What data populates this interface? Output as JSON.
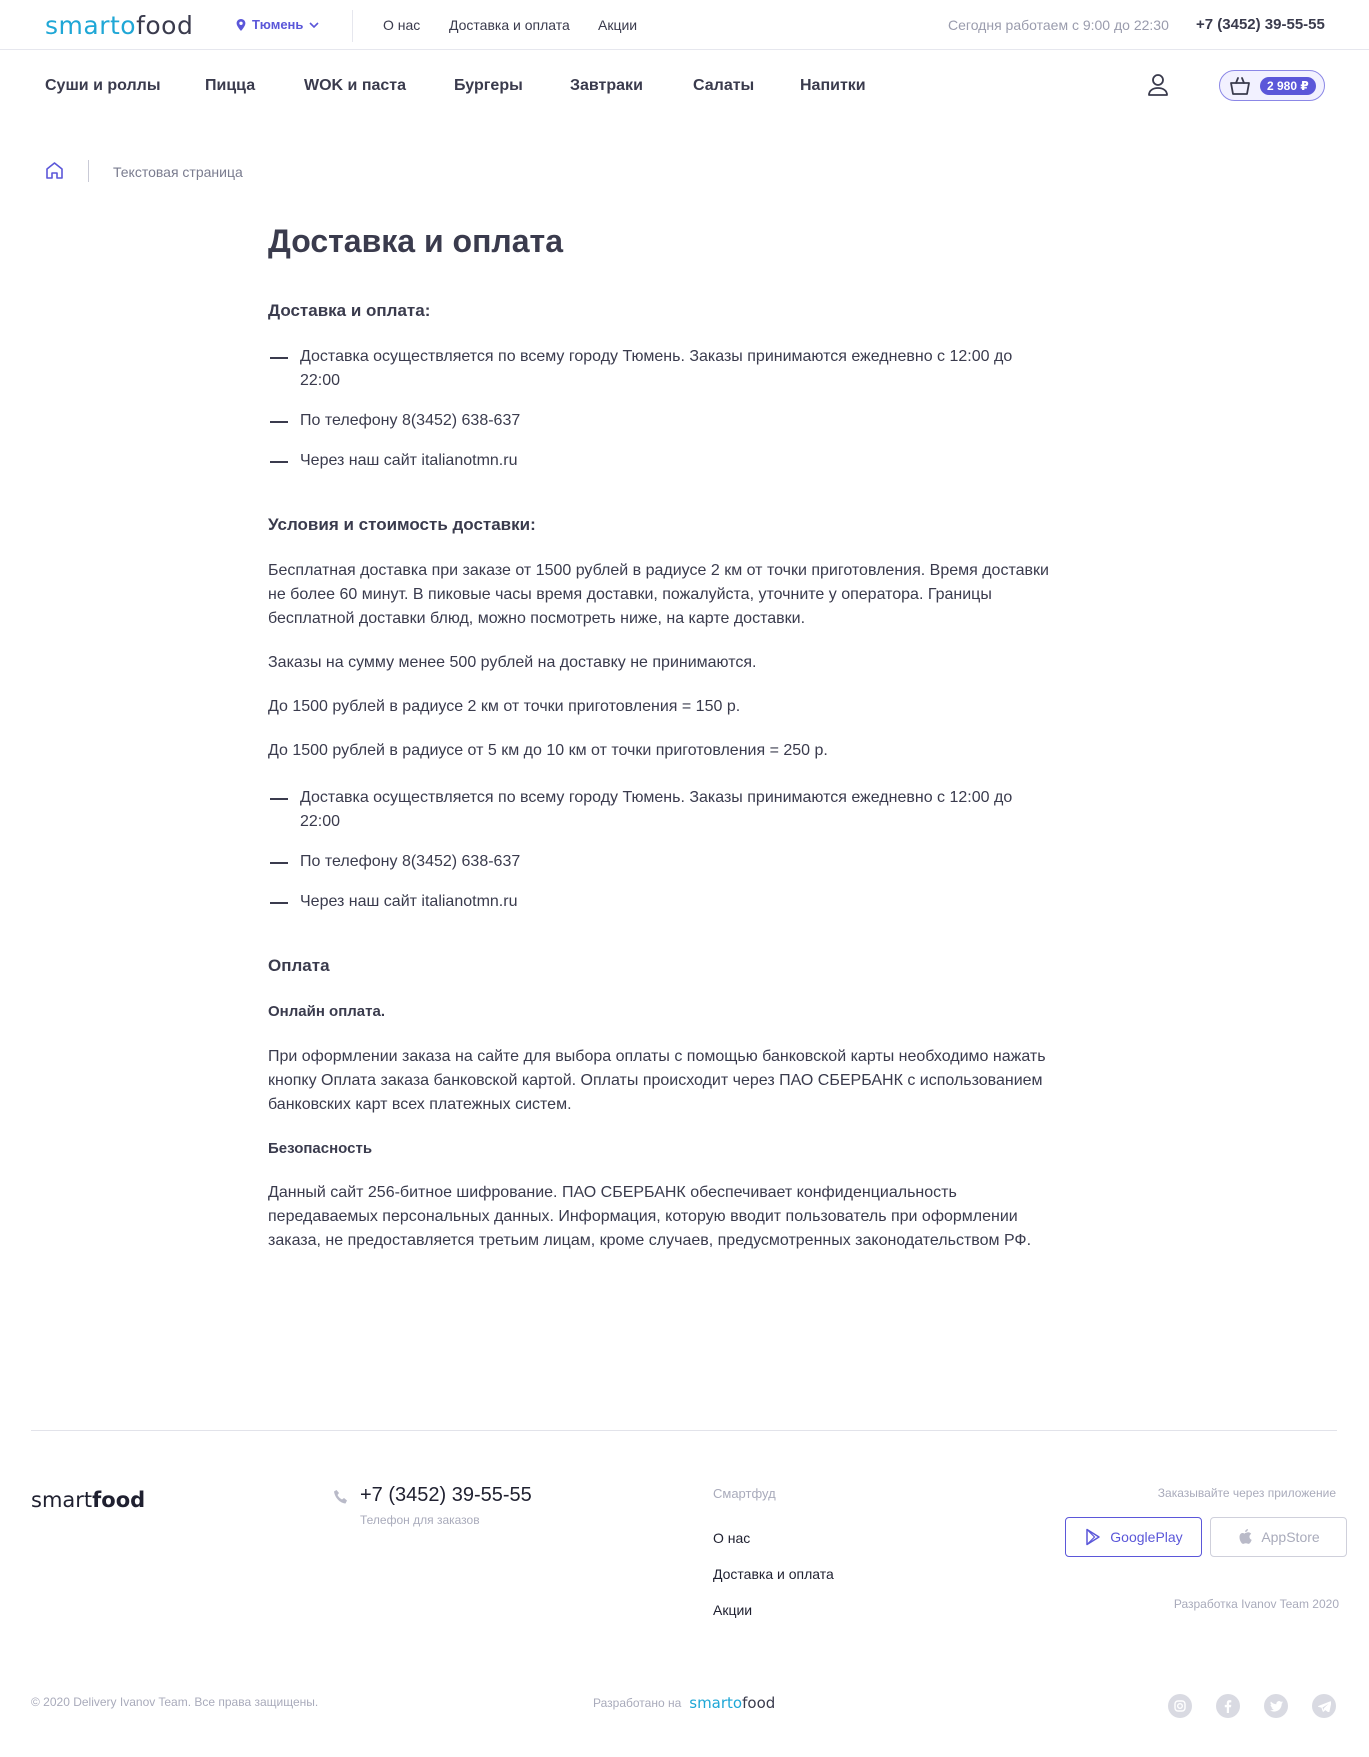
{
  "header": {
    "logo_part1": "smarto",
    "logo_part2": "food",
    "city": "Тюмень",
    "top_links": [
      "О нас",
      "Доставка и оплата",
      "Акции"
    ],
    "hours": "Сегодня работаем с 9:00 до 22:30",
    "phone": "+7 (3452) 39-55-55"
  },
  "categories": [
    "Суши и роллы",
    "Пицца",
    "WOK и паста",
    "Бургеры",
    "Завтраки",
    "Салаты",
    "Напитки"
  ],
  "cart": {
    "total": "2 980 ₽"
  },
  "breadcrumb": {
    "current": "Текстовая страница"
  },
  "content": {
    "title": "Доставка и оплата",
    "section1_heading": "Доставка и оплата:",
    "bullets": [
      "Доставка осуществляется по всему городу Тюмень. Заказы принимаются ежедневно с 12:00  до 22:00",
      "По телефону 8(3452) 638-637",
      "Через наш сайт italianotmn.ru"
    ],
    "section2_heading": "Условия и стоимость доставки:",
    "section2_paragraphs": [
      "Бесплатная доставка при заказе от 1500 рублей в радиусе 2 км от точки приготовления.  Время доставки не более 60 минут. В пиковые часы время доставки, пожалуйста, уточните у оператора. Границы бесплатной доставки блюд, можно посмотреть ниже, на карте доставки.",
      "Заказы на сумму менее 500 рублей на доставку не принимаются.",
      "До 1500 рублей в радиусе 2 км от точки приготовления = 150 р.",
      "До 1500 рублей в радиусе от 5 км до 10 км от точки приготовления = 250 р."
    ],
    "section3_heading": "Оплата",
    "online_heading": "Онлайн оплата.",
    "online_text": "При оформлении заказа на сайте для выбора оплаты с помощью банковской карты необходимо нажать кнопку Оплата заказа банковской картой. Оплаты происходит через ПАО СБЕРБАНК  с использованием банковских карт  всех платежных систем.",
    "security_heading": "Безопасность",
    "security_text": "Данный сайт 256-битное шифрование. ПАО СБЕРБАНК обеспечивает конфиденциальность передаваемых персональных данных. Информация, которую вводит пользователь при оформлении заказа, не предоставляется третьим лицам, кроме случаев, предусмотренных законодательством РФ."
  },
  "footer": {
    "logo_light": "smart",
    "logo_bold": "food",
    "phone": "+7 (3452) 39-55-55",
    "phone_caption": "Телефон для заказов",
    "links_title": "Смартфуд",
    "links": [
      "О нас",
      "Доставка и оплата",
      "Акции"
    ],
    "apps_title": "Заказывайте через приложение",
    "google_play": "GooglePlay",
    "app_store": "AppStore",
    "developer": "Разработка Ivanov Team 2020",
    "copyright": "© 2020 Delivery Ivanov Team. Все права защищены.",
    "made_with": "Разработано на",
    "made_logo_part1": "smarto",
    "made_logo_part2": "food"
  },
  "colors": {
    "accent": "#5b57d9",
    "logo_blue": "#1fa7d6",
    "text": "#3a3b4d",
    "muted": "#a9abbb"
  }
}
